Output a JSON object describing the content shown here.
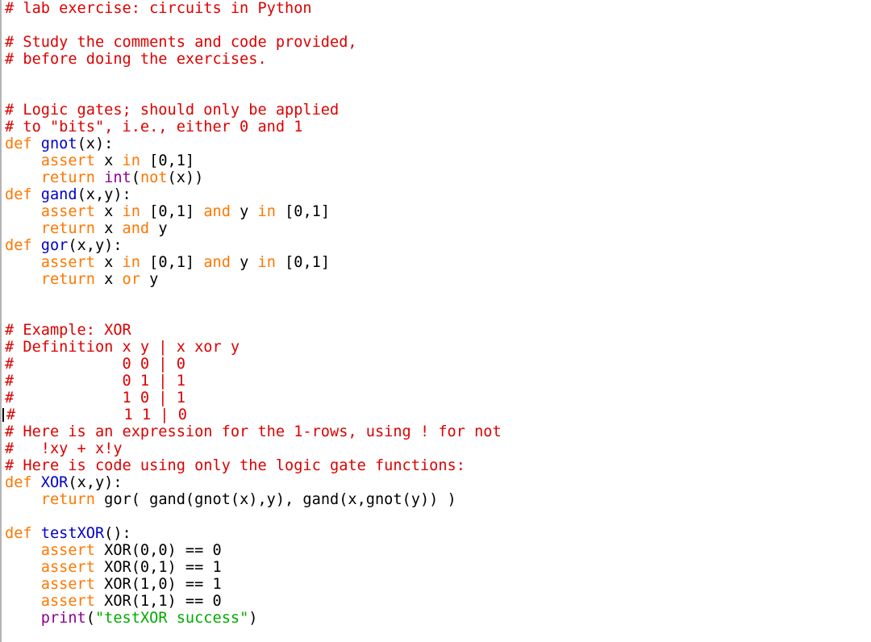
{
  "window": {
    "title": "lab exercise: circuits in Python",
    "background_color": "#ffffff",
    "gutter_border_color": "#b4b4b4"
  },
  "theme": {
    "comment_color": "#dd0000",
    "keyword_color": "#ff7700",
    "builtin_color": "#900090",
    "definition_color": "#0000cc",
    "string_color": "#00aa00",
    "plain_color": "#000000",
    "caret_color": "#000000"
  },
  "caret": {
    "line_index": 24,
    "column": 0,
    "visible": true
  },
  "code": {
    "language": "python",
    "lines": [
      {
        "n": 1,
        "segments": [
          {
            "t": "# lab exercise: circuits in Python",
            "c": "comment"
          }
        ]
      },
      {
        "n": 2,
        "segments": []
      },
      {
        "n": 3,
        "segments": [
          {
            "t": "# Study the comments and code provided,",
            "c": "comment"
          }
        ]
      },
      {
        "n": 4,
        "segments": [
          {
            "t": "# before doing the exercises.",
            "c": "comment"
          }
        ]
      },
      {
        "n": 5,
        "segments": []
      },
      {
        "n": 6,
        "segments": []
      },
      {
        "n": 7,
        "segments": [
          {
            "t": "# Logic gates; should only be applied",
            "c": "comment"
          }
        ]
      },
      {
        "n": 8,
        "segments": [
          {
            "t": "# to \"bits\", i.e., either 0 and 1",
            "c": "comment"
          }
        ]
      },
      {
        "n": 9,
        "segments": [
          {
            "t": "def ",
            "c": "keyword"
          },
          {
            "t": "gnot",
            "c": "defname"
          },
          {
            "t": "(x):",
            "c": "plain"
          }
        ]
      },
      {
        "n": 10,
        "segments": [
          {
            "t": "    ",
            "c": "plain"
          },
          {
            "t": "assert",
            "c": "keyword"
          },
          {
            "t": " x ",
            "c": "plain"
          },
          {
            "t": "in",
            "c": "keyword"
          },
          {
            "t": " [0,1]",
            "c": "plain"
          }
        ]
      },
      {
        "n": 11,
        "segments": [
          {
            "t": "    ",
            "c": "plain"
          },
          {
            "t": "return",
            "c": "keyword"
          },
          {
            "t": " ",
            "c": "plain"
          },
          {
            "t": "int",
            "c": "builtin"
          },
          {
            "t": "(",
            "c": "plain"
          },
          {
            "t": "not",
            "c": "keyword"
          },
          {
            "t": "(x))",
            "c": "plain"
          }
        ]
      },
      {
        "n": 12,
        "segments": [
          {
            "t": "def ",
            "c": "keyword"
          },
          {
            "t": "gand",
            "c": "defname"
          },
          {
            "t": "(x,y):",
            "c": "plain"
          }
        ]
      },
      {
        "n": 13,
        "segments": [
          {
            "t": "    ",
            "c": "plain"
          },
          {
            "t": "assert",
            "c": "keyword"
          },
          {
            "t": " x ",
            "c": "plain"
          },
          {
            "t": "in",
            "c": "keyword"
          },
          {
            "t": " [0,1] ",
            "c": "plain"
          },
          {
            "t": "and",
            "c": "keyword"
          },
          {
            "t": " y ",
            "c": "plain"
          },
          {
            "t": "in",
            "c": "keyword"
          },
          {
            "t": " [0,1]",
            "c": "plain"
          }
        ]
      },
      {
        "n": 14,
        "segments": [
          {
            "t": "    ",
            "c": "plain"
          },
          {
            "t": "return",
            "c": "keyword"
          },
          {
            "t": " x ",
            "c": "plain"
          },
          {
            "t": "and",
            "c": "keyword"
          },
          {
            "t": " y",
            "c": "plain"
          }
        ]
      },
      {
        "n": 15,
        "segments": [
          {
            "t": "def ",
            "c": "keyword"
          },
          {
            "t": "gor",
            "c": "defname"
          },
          {
            "t": "(x,y):",
            "c": "plain"
          }
        ]
      },
      {
        "n": 16,
        "segments": [
          {
            "t": "    ",
            "c": "plain"
          },
          {
            "t": "assert",
            "c": "keyword"
          },
          {
            "t": " x ",
            "c": "plain"
          },
          {
            "t": "in",
            "c": "keyword"
          },
          {
            "t": " [0,1] ",
            "c": "plain"
          },
          {
            "t": "and",
            "c": "keyword"
          },
          {
            "t": " y ",
            "c": "plain"
          },
          {
            "t": "in",
            "c": "keyword"
          },
          {
            "t": " [0,1]",
            "c": "plain"
          }
        ]
      },
      {
        "n": 17,
        "segments": [
          {
            "t": "    ",
            "c": "plain"
          },
          {
            "t": "return",
            "c": "keyword"
          },
          {
            "t": " x ",
            "c": "plain"
          },
          {
            "t": "or",
            "c": "keyword"
          },
          {
            "t": " y",
            "c": "plain"
          }
        ]
      },
      {
        "n": 18,
        "segments": []
      },
      {
        "n": 19,
        "segments": []
      },
      {
        "n": 20,
        "segments": [
          {
            "t": "# Example: XOR",
            "c": "comment"
          }
        ]
      },
      {
        "n": 21,
        "segments": [
          {
            "t": "# Definition x y | x xor y",
            "c": "comment"
          }
        ]
      },
      {
        "n": 22,
        "segments": [
          {
            "t": "#            0 0 | 0",
            "c": "comment"
          }
        ]
      },
      {
        "n": 23,
        "segments": [
          {
            "t": "#            0 1 | 1",
            "c": "comment"
          }
        ]
      },
      {
        "n": 24,
        "segments": [
          {
            "t": "#            1 0 | 1",
            "c": "comment"
          }
        ]
      },
      {
        "n": 25,
        "segments": [
          {
            "t": "#            1 1 | 0",
            "c": "comment"
          }
        ]
      },
      {
        "n": 26,
        "segments": [
          {
            "t": "# Here is an expression for the 1-rows, using ! for not",
            "c": "comment"
          }
        ]
      },
      {
        "n": 27,
        "segments": [
          {
            "t": "#   !xy + x!y",
            "c": "comment"
          }
        ]
      },
      {
        "n": 28,
        "segments": [
          {
            "t": "# Here is code using only the logic gate functions:",
            "c": "comment"
          }
        ]
      },
      {
        "n": 29,
        "segments": [
          {
            "t": "def ",
            "c": "keyword"
          },
          {
            "t": "XOR",
            "c": "defname"
          },
          {
            "t": "(x,y):",
            "c": "plain"
          }
        ]
      },
      {
        "n": 30,
        "segments": [
          {
            "t": "    ",
            "c": "plain"
          },
          {
            "t": "return",
            "c": "keyword"
          },
          {
            "t": " gor( gand(gnot(x),y), gand(x,gnot(y)) )",
            "c": "plain"
          }
        ]
      },
      {
        "n": 31,
        "segments": []
      },
      {
        "n": 32,
        "segments": [
          {
            "t": "def ",
            "c": "keyword"
          },
          {
            "t": "testXOR",
            "c": "defname"
          },
          {
            "t": "():",
            "c": "plain"
          }
        ]
      },
      {
        "n": 33,
        "segments": [
          {
            "t": "    ",
            "c": "plain"
          },
          {
            "t": "assert",
            "c": "keyword"
          },
          {
            "t": " XOR(0,0) == 0",
            "c": "plain"
          }
        ]
      },
      {
        "n": 34,
        "segments": [
          {
            "t": "    ",
            "c": "plain"
          },
          {
            "t": "assert",
            "c": "keyword"
          },
          {
            "t": " XOR(0,1) == 1",
            "c": "plain"
          }
        ]
      },
      {
        "n": 35,
        "segments": [
          {
            "t": "    ",
            "c": "plain"
          },
          {
            "t": "assert",
            "c": "keyword"
          },
          {
            "t": " XOR(1,0) == 1",
            "c": "plain"
          }
        ]
      },
      {
        "n": 36,
        "segments": [
          {
            "t": "    ",
            "c": "plain"
          },
          {
            "t": "assert",
            "c": "keyword"
          },
          {
            "t": " XOR(1,1) == 0",
            "c": "plain"
          }
        ]
      },
      {
        "n": 37,
        "segments": [
          {
            "t": "    ",
            "c": "plain"
          },
          {
            "t": "print",
            "c": "builtin"
          },
          {
            "t": "(",
            "c": "plain"
          },
          {
            "t": "\"testXOR success\"",
            "c": "string"
          },
          {
            "t": ")",
            "c": "plain"
          }
        ]
      }
    ]
  }
}
